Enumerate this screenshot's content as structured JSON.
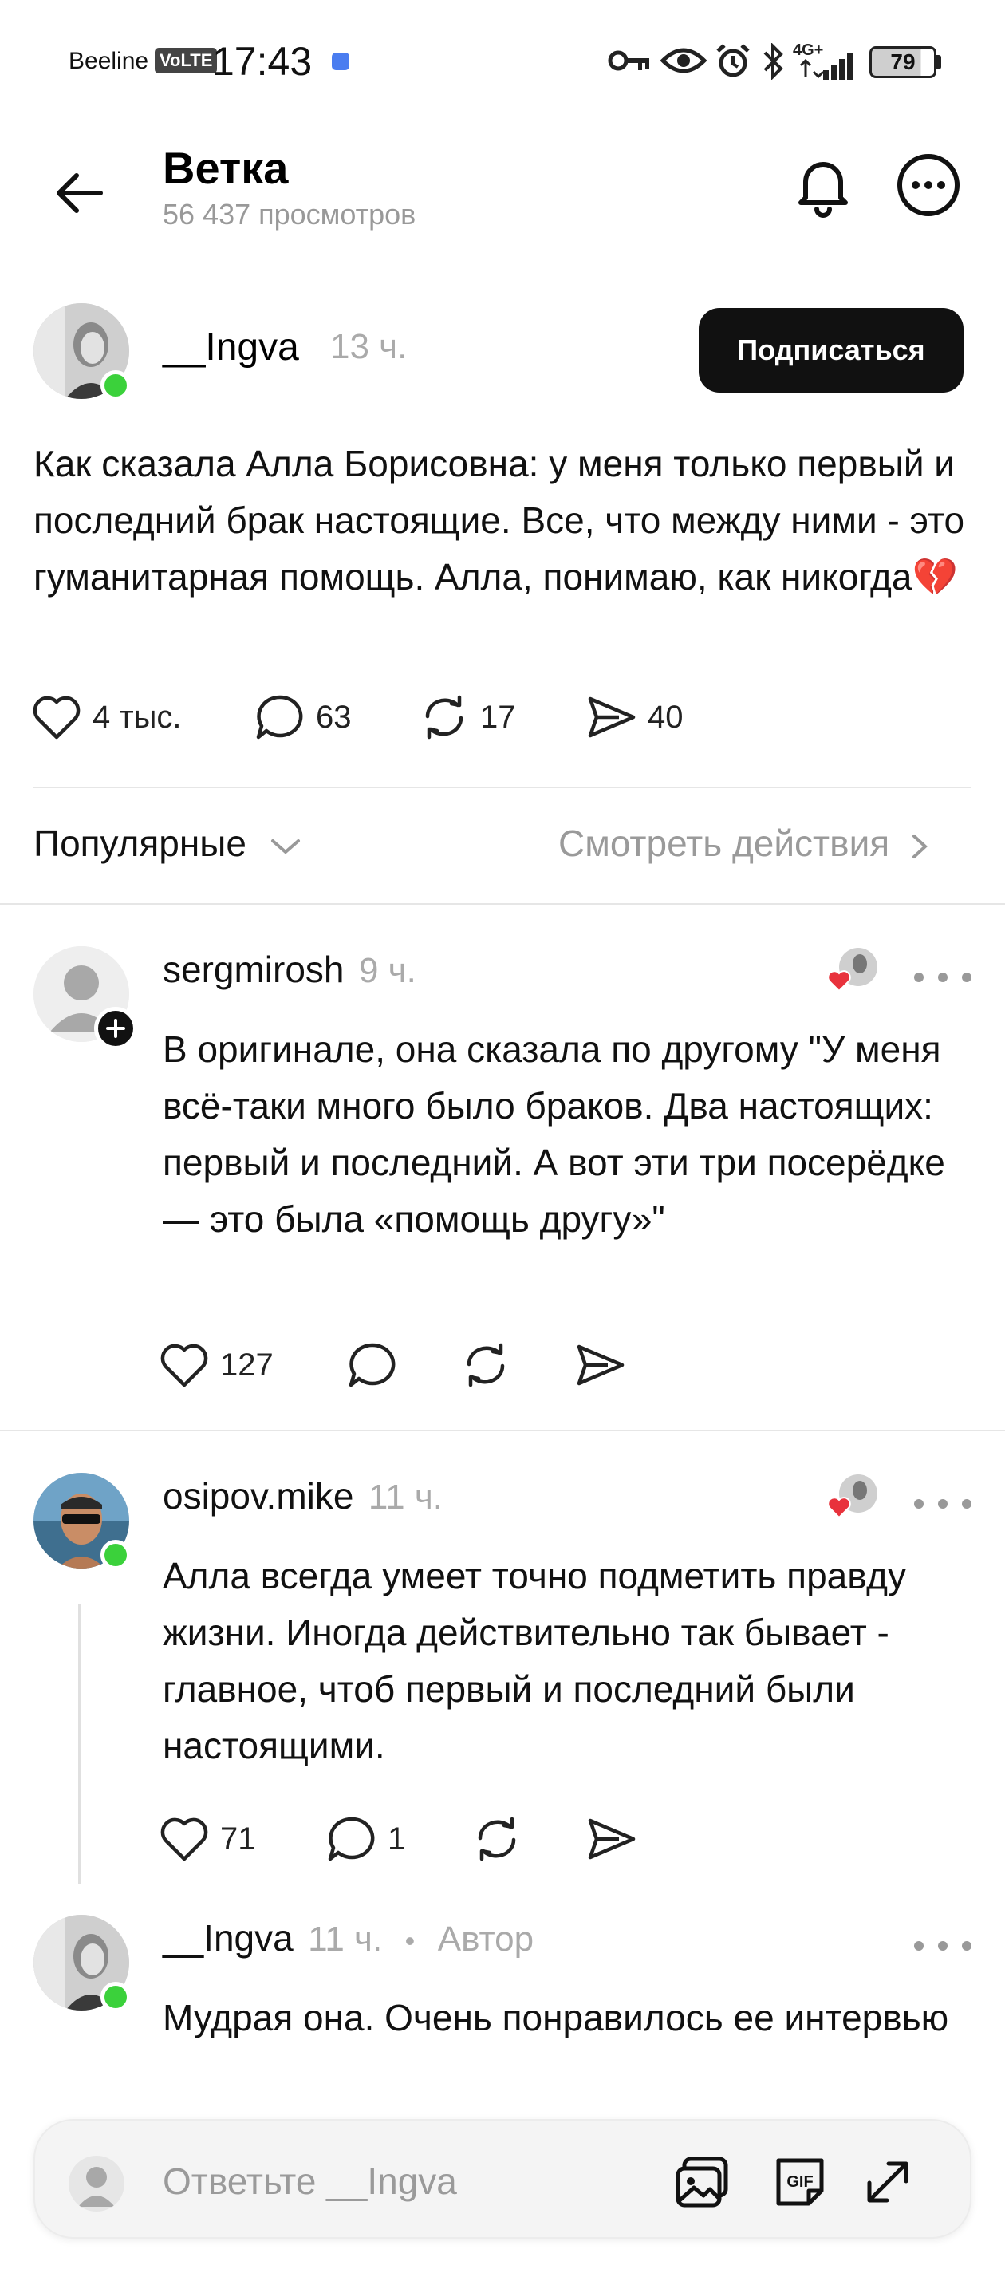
{
  "status_bar": {
    "carrier": "Beeline",
    "volte": "VoLTE",
    "time": "17:43",
    "network": "4G+",
    "battery": "79"
  },
  "header": {
    "title": "Ветка",
    "views": "56 437 просмотров"
  },
  "post": {
    "author": "__Ingva",
    "time": "13 ч.",
    "follow_label": "Подписаться",
    "text": "Как сказала Алла Борисовна: у меня только первый и последний брак настоящие. Все, что между ними - это гуманитарная помощь. Алла, понимаю, как никогда💔",
    "likes": "4 тыс.",
    "comments": "63",
    "reposts": "17",
    "shares": "40"
  },
  "sort": {
    "label": "Популярные",
    "view_actions": "Смотреть действия"
  },
  "comments": [
    {
      "author": "sergmirosh",
      "time": "9 ч.",
      "text": "В оригинале, она сказала по другому \"У меня всё-таки много было браков. Два настоящих: первый и последний. А вот эти три посерёдке — это была «помощь другу»\"",
      "likes": "127"
    },
    {
      "author": "osipov.mike",
      "time": "11 ч.",
      "text": "Алла всегда умеет точно подметить правду жизни. Иногда действительно так бывает - главное, чтоб первый и последний были настоящими.",
      "likes": "71",
      "comments": "1"
    },
    {
      "author": "__Ingva",
      "time": "11 ч.",
      "badge": "Автор",
      "text": "Мудрая она. Очень понравилось ее интервью"
    }
  ],
  "reply": {
    "placeholder": "Ответьте __Ingva"
  },
  "colors": {
    "accent_dark": "#111111",
    "online": "#3bd13b",
    "heart_red": "#e8323c",
    "muted_text": "#999999"
  }
}
